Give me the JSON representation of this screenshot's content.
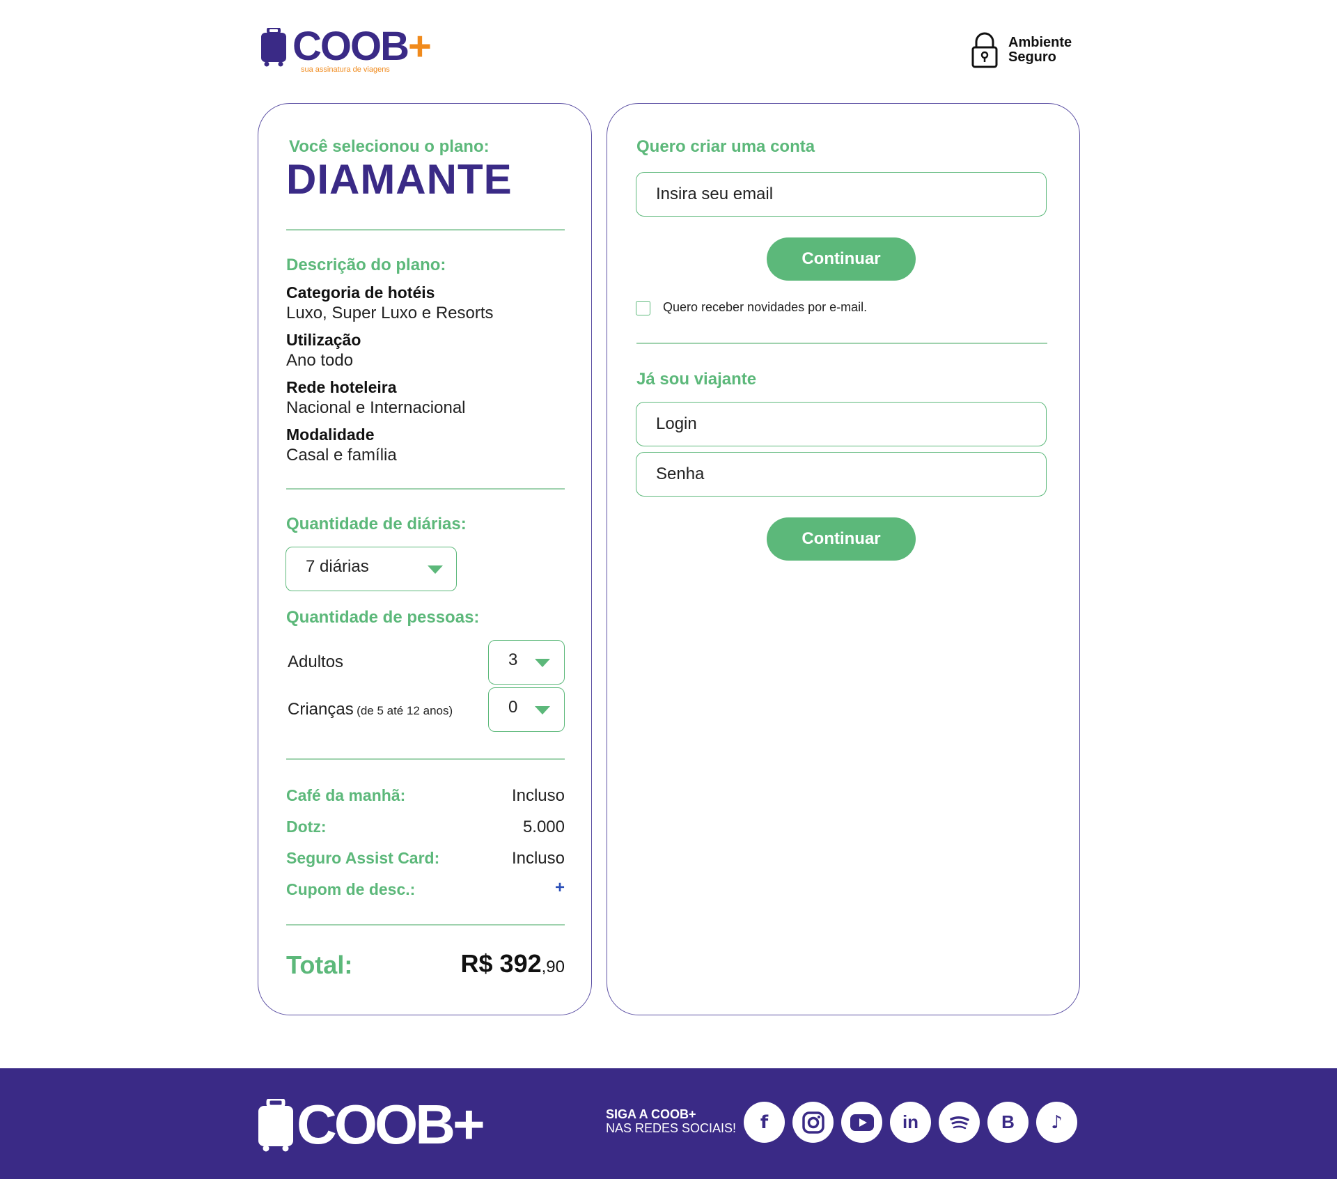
{
  "brand": {
    "name": "COOB",
    "plus": "+",
    "tagline": "sua assinatura de viagens",
    "primary_color": "#3a2a86",
    "accent_color": "#5cb87a",
    "highlight_color": "#f08a1c"
  },
  "header": {
    "secure_line1": "Ambiente",
    "secure_line2": "Seguro",
    "secure_icon": "padlock-icon"
  },
  "plan": {
    "selected_label": "Você selecionou o plano:",
    "name": "DIAMANTE",
    "description_title": "Descrição do plano:",
    "description": [
      {
        "name": "Categoria de hotéis",
        "value": "Luxo, Super Luxo e Resorts"
      },
      {
        "name": "Utilização",
        "value": "Ano todo"
      },
      {
        "name": "Rede hoteleira",
        "value": "Nacional e Internacional"
      },
      {
        "name": "Modalidade",
        "value": "Casal e família"
      }
    ]
  },
  "quantities": {
    "days_title": "Quantidade de diárias:",
    "days_value": "7 diárias",
    "people_title": "Quantidade de pessoas:",
    "adults_label": "Adultos",
    "adults_value": "3",
    "children_label": "Crianças",
    "children_note": "(de 5 até 12 anos)",
    "children_value": "0"
  },
  "extras": [
    {
      "label": "Café da manhã:",
      "value": "Incluso"
    },
    {
      "label": "Dotz:",
      "value": "5.000"
    },
    {
      "label": "Seguro Assist Card:",
      "value": "Incluso"
    }
  ],
  "coupon": {
    "label": "Cupom de desc.:",
    "action": "+"
  },
  "total": {
    "label": "Total:",
    "amount": "R$ 392",
    "cents": ",90"
  },
  "create_account": {
    "title": "Quero criar uma conta",
    "email_placeholder": "Insira seu email",
    "button": "Continuar",
    "newsletter_label": "Quero receber novidades por e-mail."
  },
  "login": {
    "title": "Já sou viajante",
    "login_placeholder": "Login",
    "password_placeholder": "Senha",
    "button": "Continuar"
  },
  "footer": {
    "brand": "COOB+",
    "follow_line1": "SIGA A COOB+",
    "follow_line2": "NAS REDES SOCIAIS!",
    "socials": [
      {
        "name": "facebook-icon",
        "glyph": "f"
      },
      {
        "name": "instagram-icon",
        "glyph": ""
      },
      {
        "name": "youtube-icon",
        "glyph": ""
      },
      {
        "name": "linkedin-icon",
        "glyph": "in"
      },
      {
        "name": "spotify-icon",
        "glyph": ""
      },
      {
        "name": "blogger-icon",
        "glyph": "B"
      },
      {
        "name": "tiktok-icon",
        "glyph": "♪"
      }
    ]
  }
}
